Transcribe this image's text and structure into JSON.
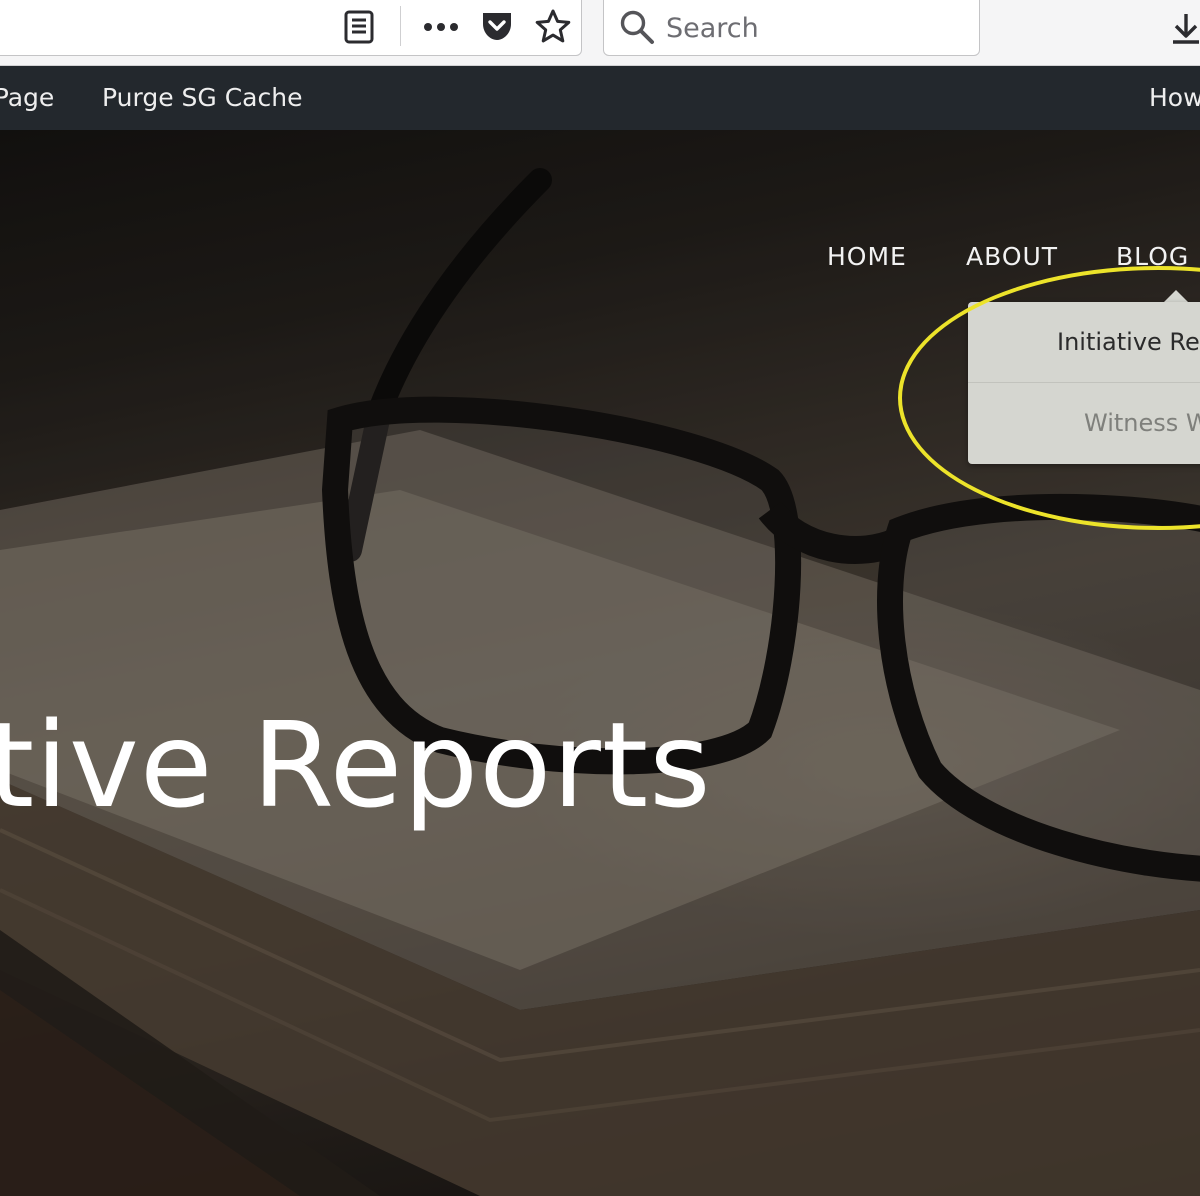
{
  "browser": {
    "search_placeholder": "Search",
    "icons": {
      "reader": "reader-view-icon",
      "more": "more-actions-icon",
      "pocket": "pocket-icon",
      "bookmark": "star-bookmark-icon",
      "search": "magnifier-icon",
      "downloads": "download-icon"
    }
  },
  "adminbar": {
    "items": [
      {
        "label": "t Page"
      },
      {
        "label": "Purge SG Cache"
      },
      {
        "label": "How"
      }
    ]
  },
  "site": {
    "nav": [
      {
        "label": "HOME"
      },
      {
        "label": "ABOUT"
      },
      {
        "label": "BLOG"
      }
    ],
    "dropdown": [
      {
        "label": "Initiative Re"
      },
      {
        "label": "Witness W"
      }
    ],
    "hero_title": "tive Reports"
  },
  "colors": {
    "toolbar_bg": "#f5f5f6",
    "adminbar_bg": "#23282d",
    "dropdown_bg": "#d5d6d0",
    "highlight": "#ece32a",
    "hero_text": "#ffffff"
  }
}
